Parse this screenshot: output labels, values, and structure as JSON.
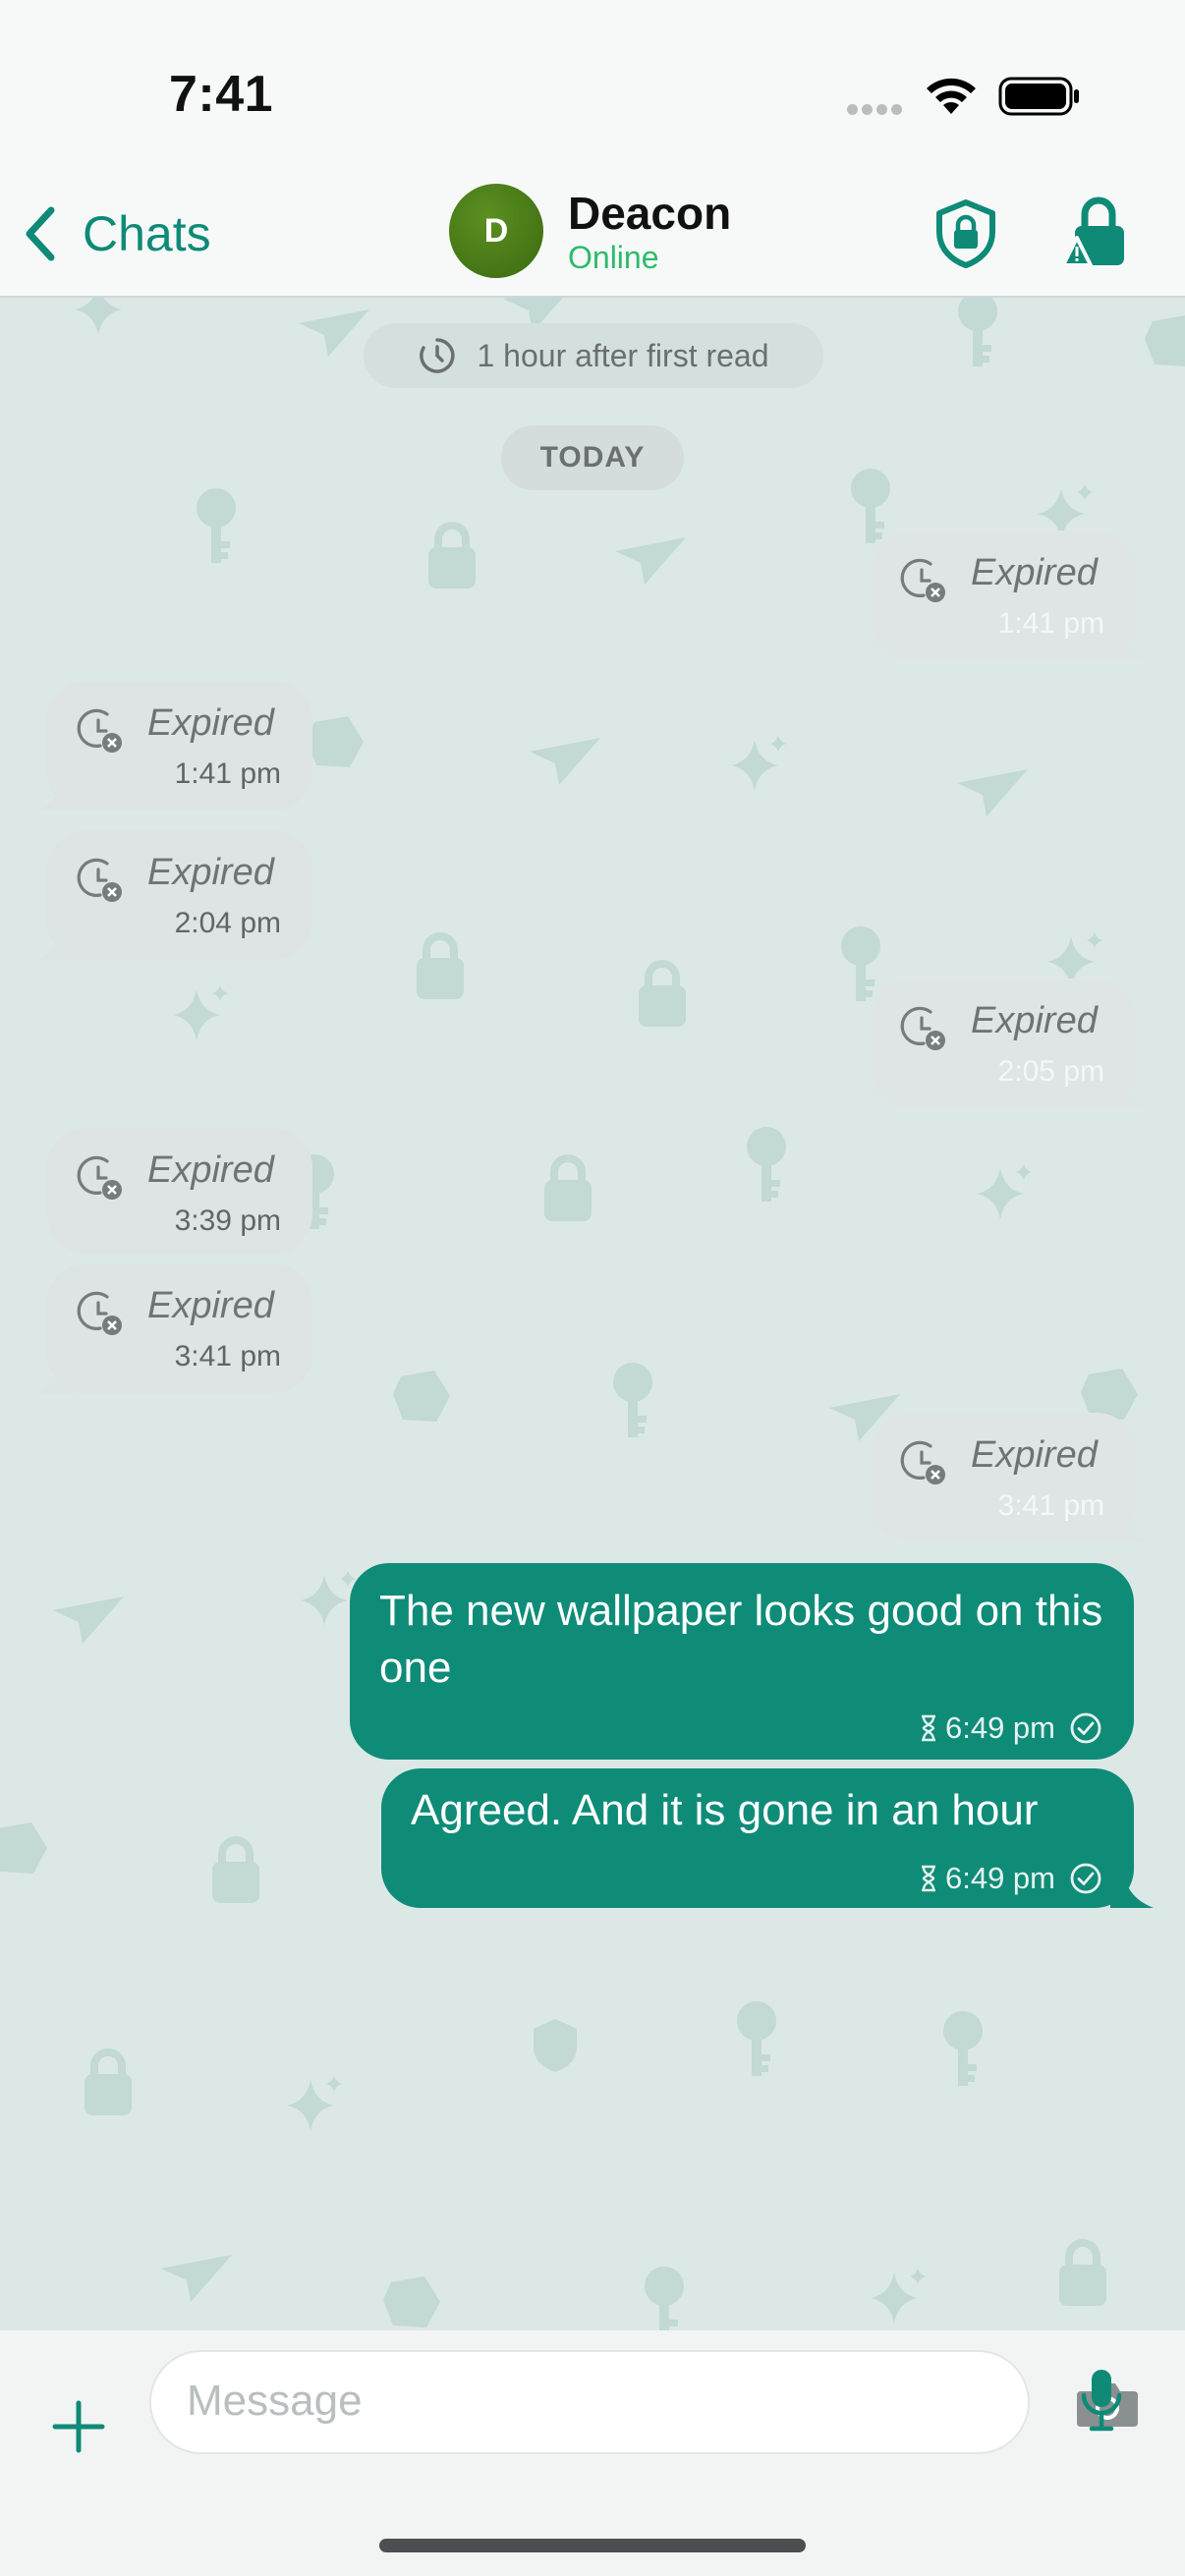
{
  "status_bar": {
    "time": "7:41"
  },
  "header": {
    "back_label": "Chats",
    "avatar_initial": "D",
    "contact_name": "Deacon",
    "contact_status": "Online"
  },
  "chat": {
    "timer_notice": "1 hour after first read",
    "date_label": "TODAY",
    "messages": [
      {
        "direction": "outgoing",
        "label": "Expired",
        "time": "1:41 pm"
      },
      {
        "direction": "incoming",
        "label": "Expired",
        "time": "1:41 pm"
      },
      {
        "direction": "incoming",
        "label": "Expired",
        "time": "2:04 pm"
      },
      {
        "direction": "outgoing",
        "label": "Expired",
        "time": "2:05 pm"
      },
      {
        "direction": "incoming",
        "label": "Expired",
        "time": "3:39 pm"
      },
      {
        "direction": "incoming",
        "label": "Expired",
        "time": "3:41 pm"
      },
      {
        "direction": "outgoing",
        "label": "Expired",
        "time": "3:41 pm"
      },
      {
        "direction": "outgoing",
        "text": "The new wallpaper looks good on this one",
        "time": "6:49 pm"
      },
      {
        "direction": "outgoing",
        "text": "Agreed. And it is gone in an hour",
        "time": "6:49 pm"
      }
    ]
  },
  "composer": {
    "placeholder": "Message"
  },
  "colors": {
    "accent": "#0e8a76",
    "outgoing_bubble": "#0f8c78",
    "online": "#2dbb6a",
    "chat_background": "#dce8e6"
  },
  "icons": [
    "chevron-left-icon",
    "shield-lock-icon",
    "lock-warning-icon",
    "timer-icon",
    "expired-clock-icon",
    "hourglass-icon",
    "read-check-icon",
    "plus-icon",
    "camera-icon",
    "mic-icon"
  ]
}
